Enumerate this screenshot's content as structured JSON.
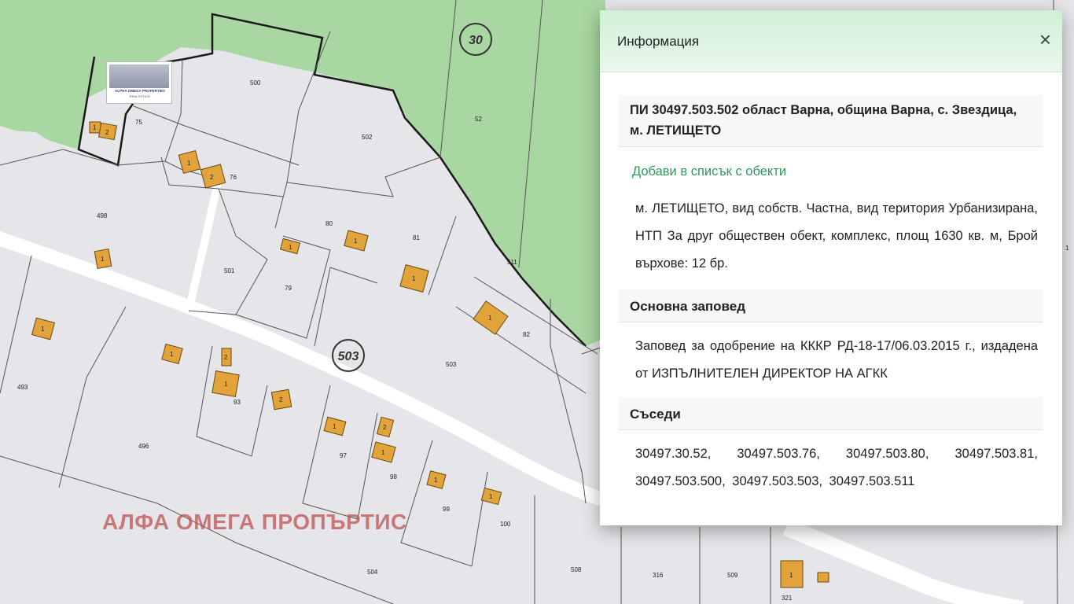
{
  "map": {
    "district_number": "503",
    "zone_number": "30",
    "parcel_labels": {
      "p75": "75",
      "p76": "76",
      "p79": "79",
      "p80": "80",
      "p81": "81",
      "p82": "82",
      "p93": "93",
      "p97": "97",
      "p98": "98",
      "p99": "99",
      "p100": "100",
      "p316": "316",
      "p321": "321",
      "p493": "493",
      "p496": "496",
      "p498": "498",
      "p500": "500",
      "p501": "501",
      "p502": "502",
      "p503": "503",
      "p504": "504",
      "p508": "508",
      "p509": "509",
      "p511": "511",
      "p52": "52",
      "p1_edge": "1"
    },
    "building_number_one": "1",
    "building_number_two": "2",
    "colors": {
      "urban_parcel": "#e6e6ea",
      "forest": "#a9d7a1",
      "road": "#ffffff",
      "building": "#e2a33a",
      "boundary": "#1a1a1a"
    }
  },
  "logo": {
    "name": "ALPHA OMEGA PROPERTIES",
    "subtitle": "REAL ESTATE"
  },
  "watermark": "АЛФА ОМЕГА ПРОПЪРТИС",
  "panel": {
    "title": "Информация",
    "close_icon": "close-icon",
    "parcel_title": "ПИ 30497.503.502 област Варна, община Варна, с. Звездица, м. ЛЕТИЩЕТО",
    "add_link": "Добави в списък с обекти",
    "parcel_description": "м. ЛЕТИЩЕТО, вид собств. Частна, вид територия Урбанизирана, НТП За друг обществен обект, комплекс, площ 1630 кв. м, Брой върхове: 12 бр.",
    "order_title": "Основна заповед",
    "order_text": "Заповед за одобрение на КККР РД-18-17/06.03.2015 г., издадена от ИЗПЪЛНИТЕЛЕН ДИРЕКТОР НА АГКК",
    "neighbors_title": "Съседи",
    "neighbors_text": "30497.30.52, 30497.503.76, 30497.503.80, 30497.503.81, 30497.503.500, 30497.503.503, 30497.503.511"
  }
}
